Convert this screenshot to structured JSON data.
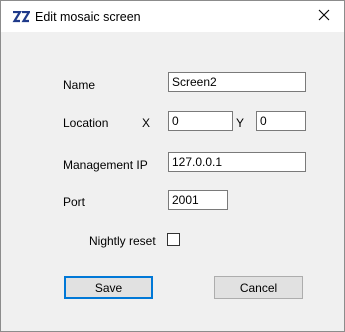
{
  "window": {
    "title": "Edit mosaic screen",
    "app_icon": "mosaic-logo-icon",
    "close_icon": "close-icon"
  },
  "form": {
    "name": {
      "label": "Name",
      "value": "Screen2"
    },
    "location": {
      "label": "Location",
      "x_label": "X",
      "x_value": "0",
      "y_label": "Y",
      "y_value": "0"
    },
    "management_ip": {
      "label": "Management IP",
      "value": "127.0.0.1"
    },
    "port": {
      "label": "Port",
      "value": "2001"
    },
    "nightly_reset": {
      "label": "Nightly reset",
      "checked": false
    }
  },
  "buttons": {
    "save": "Save",
    "cancel": "Cancel"
  },
  "colors": {
    "dialog_bg": "#f0f0f0",
    "titlebar_bg": "#ffffff",
    "default_button_border": "#0078d7",
    "icon_blue": "#1f3a8a"
  }
}
